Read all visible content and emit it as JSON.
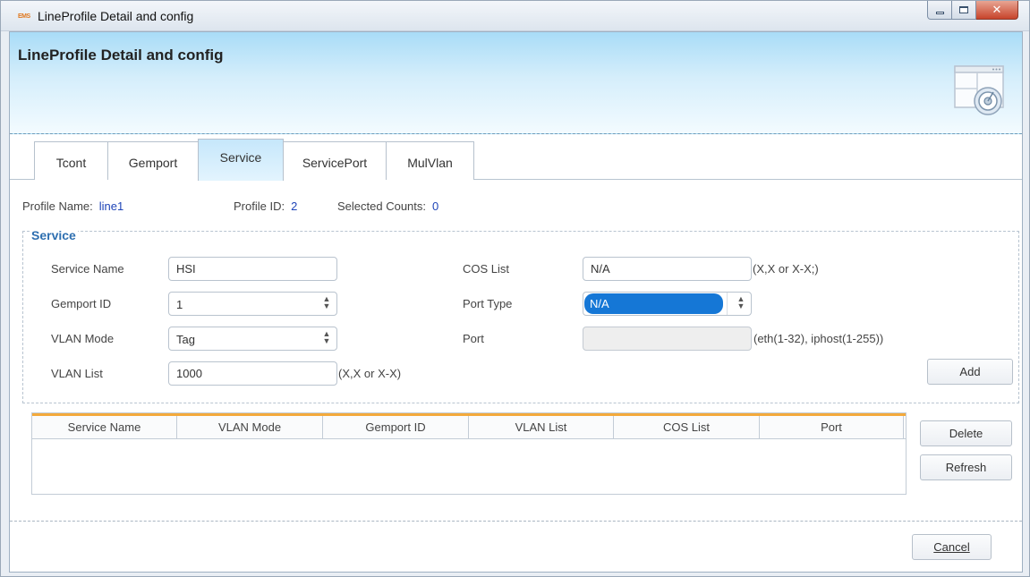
{
  "window": {
    "title": "LineProfile Detail and config",
    "icon_text": "EMS"
  },
  "banner": {
    "title": "LineProfile Detail and config"
  },
  "tabs": [
    {
      "label": "Tcont"
    },
    {
      "label": "Gemport"
    },
    {
      "label": "Service"
    },
    {
      "label": "ServicePort"
    },
    {
      "label": "MulVlan"
    }
  ],
  "info": {
    "profile_name_label": "Profile Name:",
    "profile_name_value": "line1",
    "profile_id_label": "Profile ID:",
    "profile_id_value": "2",
    "selected_counts_label": "Selected Counts:",
    "selected_counts_value": "0"
  },
  "service": {
    "legend": "Service",
    "service_name_label": "Service Name",
    "service_name_value": "HSI",
    "gemport_id_label": "Gemport ID",
    "gemport_id_value": "1",
    "vlan_mode_label": "VLAN Mode",
    "vlan_mode_value": "Tag",
    "vlan_list_label": "VLAN List",
    "vlan_list_value": "1000",
    "vlan_list_hint": "(X,X or X-X)",
    "cos_list_label": "COS List",
    "cos_list_value": "N/A",
    "cos_list_hint": "(X,X or X-X;)",
    "port_type_label": "Port Type",
    "port_type_value": "N/A",
    "port_label": "Port",
    "port_value": "",
    "port_hint": "(eth(1-32), iphost(1-255))",
    "add_label": "Add"
  },
  "table": {
    "columns": [
      "Service Name",
      "VLAN Mode",
      "Gemport ID",
      "VLAN List",
      "COS List",
      "Port"
    ],
    "rows": []
  },
  "buttons": {
    "delete_label": "Delete",
    "refresh_label": "Refresh",
    "cancel_label": "Cancel"
  }
}
